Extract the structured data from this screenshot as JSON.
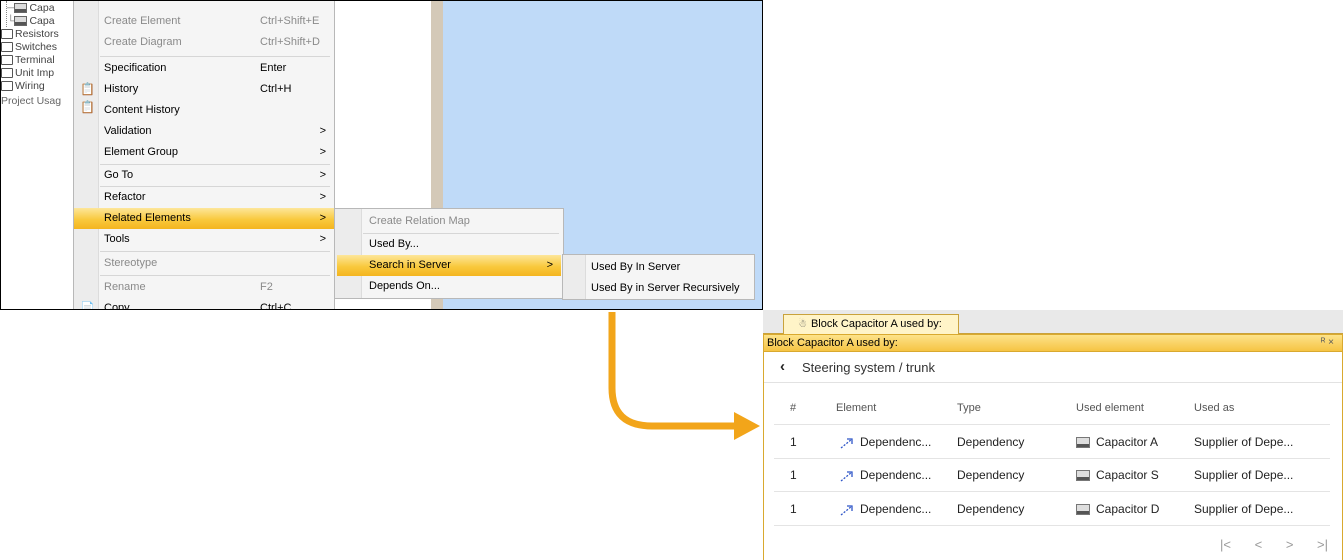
{
  "tree": {
    "items": [
      {
        "label": "Capa",
        "kind": "block"
      },
      {
        "label": "Capa",
        "kind": "block"
      },
      {
        "label": "Resistors",
        "kind": "folder"
      },
      {
        "label": "Switches",
        "kind": "folder"
      },
      {
        "label": "Terminal",
        "kind": "folder"
      },
      {
        "label": "Unit Imp",
        "kind": "folder"
      },
      {
        "label": "Wiring",
        "kind": "folder"
      },
      {
        "label": "Project Usag",
        "kind": "text"
      }
    ]
  },
  "context_menu": {
    "items": [
      {
        "label": "Create Element",
        "shortcut": "Ctrl+Shift+E",
        "disabled": true
      },
      {
        "label": "Create Diagram",
        "shortcut": "Ctrl+Shift+D",
        "disabled": true
      },
      {
        "label": "Specification",
        "shortcut": "Enter"
      },
      {
        "label": "History",
        "shortcut": "Ctrl+H",
        "icon": "history-icon"
      },
      {
        "label": "Content History",
        "icon": "content-history-icon"
      },
      {
        "label": "Validation",
        "arrow": ">"
      },
      {
        "label": "Element Group",
        "arrow": ">"
      },
      {
        "label": "Go To",
        "arrow": ">"
      },
      {
        "label": "Refactor",
        "arrow": ">"
      },
      {
        "label": "Related Elements",
        "arrow": ">",
        "highlighted": true
      },
      {
        "label": "Tools",
        "arrow": ">"
      },
      {
        "label": "Stereotype",
        "disabled": true
      },
      {
        "label": "Rename",
        "shortcut": "F2",
        "disabled": true
      },
      {
        "label": "Copy",
        "shortcut": "Ctrl+C",
        "icon": "copy-icon"
      }
    ]
  },
  "related_menu": {
    "items": [
      {
        "label": "Create Relation Map",
        "disabled": true
      },
      {
        "label": "Used By..."
      },
      {
        "label": "Search in Server",
        "arrow": ">",
        "highlighted": true
      },
      {
        "label": "Depends On..."
      }
    ]
  },
  "server_menu": {
    "items": [
      {
        "label": "Used By In Server"
      },
      {
        "label": "Used By in Server Recursively"
      }
    ]
  },
  "panel": {
    "tab_label": "Block Capacitor A used by:",
    "title": "Block Capacitor A used by:",
    "window_controls": "ᴿ ×",
    "breadcrumb": "Steering system / trunk",
    "columns": [
      "#",
      "Element",
      "Type",
      "Used element",
      "Used as"
    ],
    "rows": [
      {
        "num": "1",
        "element": "Dependenc...",
        "type": "Dependency",
        "used_element": "Capacitor A",
        "used_as": "Supplier of Depe..."
      },
      {
        "num": "1",
        "element": "Dependenc...",
        "type": "Dependency",
        "used_element": "Capacitor S",
        "used_as": "Supplier of Depe..."
      },
      {
        "num": "1",
        "element": "Dependenc...",
        "type": "Dependency",
        "used_element": "Capacitor D",
        "used_as": "Supplier of Depe..."
      }
    ],
    "pager": {
      "first": "|<",
      "prev": "<",
      "next": ">",
      "last": ">|"
    }
  },
  "colors": {
    "highlight": "#f9c93d",
    "canvas_blue": "#bfdaf8",
    "arrow_orange": "#f2a51a",
    "panel_title": "#f6c444"
  }
}
